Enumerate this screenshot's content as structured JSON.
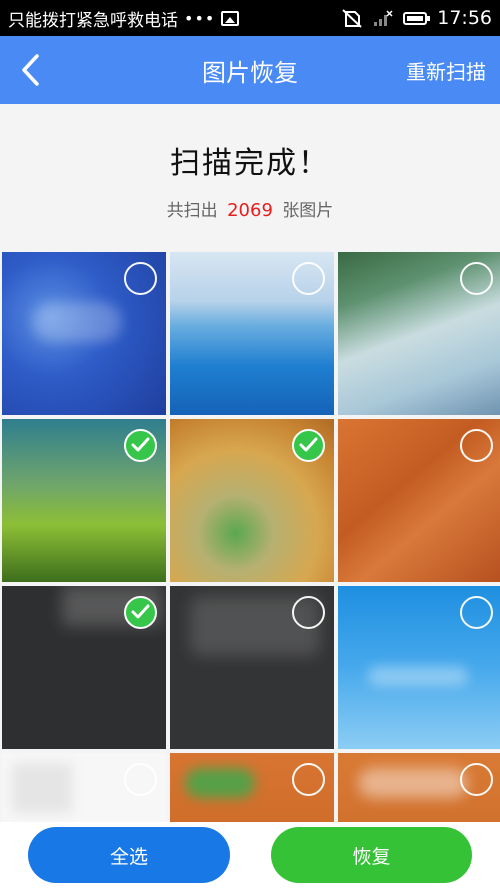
{
  "status_bar": {
    "carrier_text": "只能拨打紧急呼救电话",
    "dots": "•••",
    "time": "17:56"
  },
  "header": {
    "title": "图片恢复",
    "rescan_label": "重新扫描"
  },
  "summary": {
    "title": "扫描完成！",
    "count_prefix": "共扫出",
    "count": "2069",
    "count_suffix": "张图片"
  },
  "photos": [
    {
      "selected": false
    },
    {
      "selected": false
    },
    {
      "selected": false
    },
    {
      "selected": true
    },
    {
      "selected": true
    },
    {
      "selected": false
    },
    {
      "selected": true
    },
    {
      "selected": false
    },
    {
      "selected": false
    },
    {
      "selected": false
    },
    {
      "selected": false
    },
    {
      "selected": false
    }
  ],
  "footer": {
    "select_all_label": "全选",
    "restore_label": "恢复"
  },
  "colors": {
    "header_bg": "#4a8af5",
    "highlight": "#e81d1d",
    "check_on": "#35c64a",
    "select_all_bg": "#1878e6",
    "restore_bg": "#36c236"
  },
  "icons": [
    "image-icon",
    "no-sim-icon",
    "signal-icon",
    "battery-icon",
    "back-arrow-icon",
    "checkmark-icon"
  ]
}
